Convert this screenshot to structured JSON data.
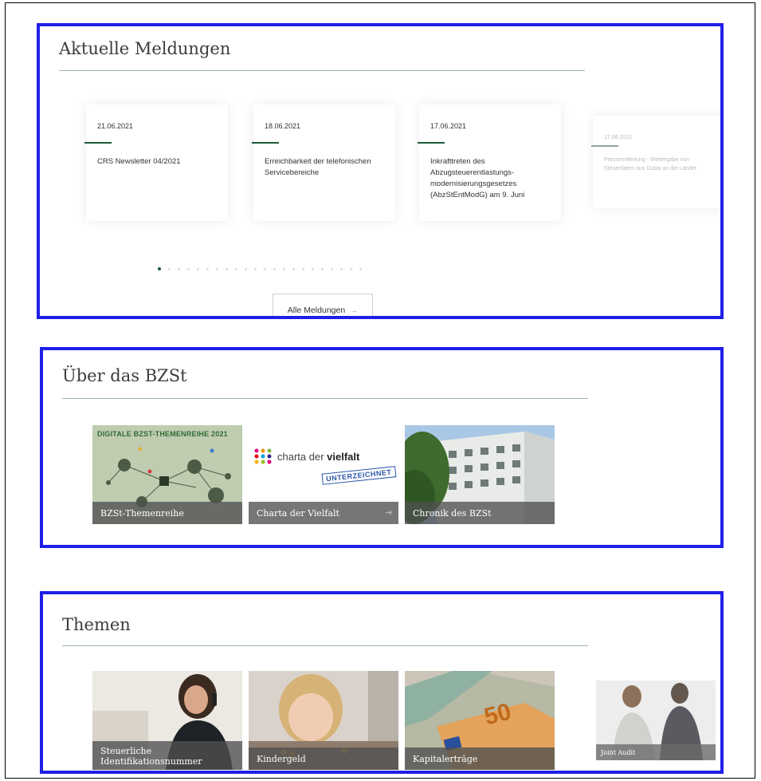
{
  "news": {
    "title": "Aktuelle Meldungen",
    "items": [
      {
        "date": "21.06.2021",
        "title": "CRS Newsletter 04/2021"
      },
      {
        "date": "18.06.2021",
        "title": "Erreichbarkeit der telefonischen Servicebereiche"
      },
      {
        "date": "17.06.2021",
        "title": "Inkrafttreten des Abzugsteuerentlastungs-modernisierungsgesetzes (AbzStEntModG) am 9. Juni"
      },
      {
        "date": "17.06.2021",
        "title": "Pressemitteilung - Weitergabe von Steuerdaten aus Dubai an die Länder"
      }
    ],
    "dot_count": 22,
    "active_dot": 0,
    "button_label": "Alle Meldungen",
    "button_arrow": "→"
  },
  "about": {
    "title": "Über das BZSt",
    "tiles": [
      {
        "label": "BZSt-Themenreihe",
        "banner": "DIGITALE BZST-THEMENREIHE 2021"
      },
      {
        "label": "Charta der Vielfalt",
        "logo_text": "charta der ",
        "logo_bold": "vielfalt",
        "stamp": "UNTERZEICHNET",
        "ext_icon": "⇥"
      },
      {
        "label": "Chronik des BZSt"
      }
    ]
  },
  "themes": {
    "title": "Themen",
    "tiles": [
      {
        "label": "Steuerliche Identifikationsnummer"
      },
      {
        "label": "Kindergeld"
      },
      {
        "label": "Kapitalerträge",
        "note": "50"
      },
      {
        "label": "Joint Audit"
      }
    ]
  },
  "colors": {
    "panel_border": "#1f1fe8",
    "accent_green": "#1d5b3b"
  }
}
